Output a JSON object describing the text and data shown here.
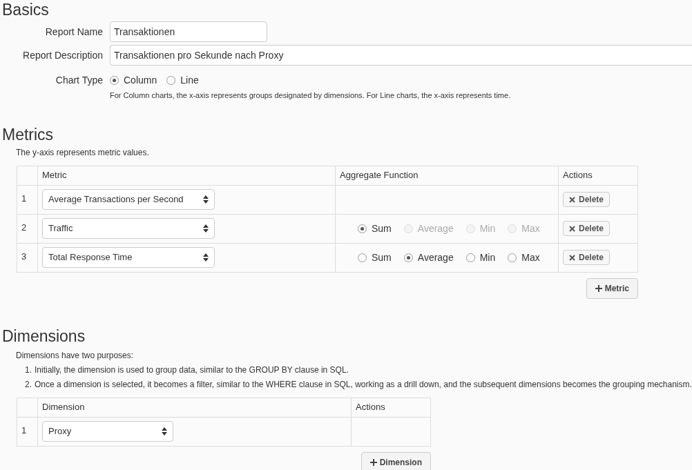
{
  "basics": {
    "title": "Basics",
    "fields": [
      {
        "label": "Report Name",
        "value": "Transaktionen",
        "kind": "short"
      },
      {
        "label": "Report Description",
        "value": "Transaktionen pro Sekunde nach Proxy",
        "kind": "wide"
      }
    ],
    "chart_type": {
      "label": "Chart Type",
      "options": [
        {
          "label": "Column",
          "selected": true
        },
        {
          "label": "Line",
          "selected": false
        }
      ],
      "help": "For Column charts, the x-axis represents groups designated by dimensions. For Line charts, the x-axis represents time."
    }
  },
  "metrics": {
    "title": "Metrics",
    "description": "The y-axis represents metric values.",
    "columns": [
      "Metric",
      "Aggregate Function",
      "Actions"
    ],
    "rows": [
      {
        "number": "1",
        "metric": "Average Transactions per Second",
        "aggregates": [],
        "action": "Delete"
      },
      {
        "number": "2",
        "metric": "Traffic",
        "aggregates": [
          {
            "label": "Sum",
            "selected": true,
            "disabled": false
          },
          {
            "label": "Average",
            "selected": false,
            "disabled": true
          },
          {
            "label": "Min",
            "selected": false,
            "disabled": true
          },
          {
            "label": "Max",
            "selected": false,
            "disabled": true
          }
        ],
        "action": "Delete"
      },
      {
        "number": "3",
        "metric": "Total Response Time",
        "aggregates": [
          {
            "label": "Sum",
            "selected": false,
            "disabled": false
          },
          {
            "label": "Average",
            "selected": true,
            "disabled": false
          },
          {
            "label": "Min",
            "selected": false,
            "disabled": false
          },
          {
            "label": "Max",
            "selected": false,
            "disabled": false
          }
        ],
        "action": "Delete"
      }
    ],
    "add_button": "Metric"
  },
  "dimensions": {
    "title": "Dimensions",
    "intro": "Dimensions have two purposes:",
    "points": [
      {
        "number": "1.",
        "text": "Initially, the dimension is used to group data, similar to the GROUP BY clause in SQL."
      },
      {
        "number": "2.",
        "text": "Once a dimension is selected, it becomes a filter, similar to the WHERE clause in SQL, working as a drill down, and the subsequent dimensions becomes the grouping mechanism."
      }
    ],
    "columns": [
      "Dimension",
      "Actions"
    ],
    "rows": [
      {
        "number": "1",
        "dimension": "Proxy"
      }
    ],
    "add_button": "Dimension"
  }
}
